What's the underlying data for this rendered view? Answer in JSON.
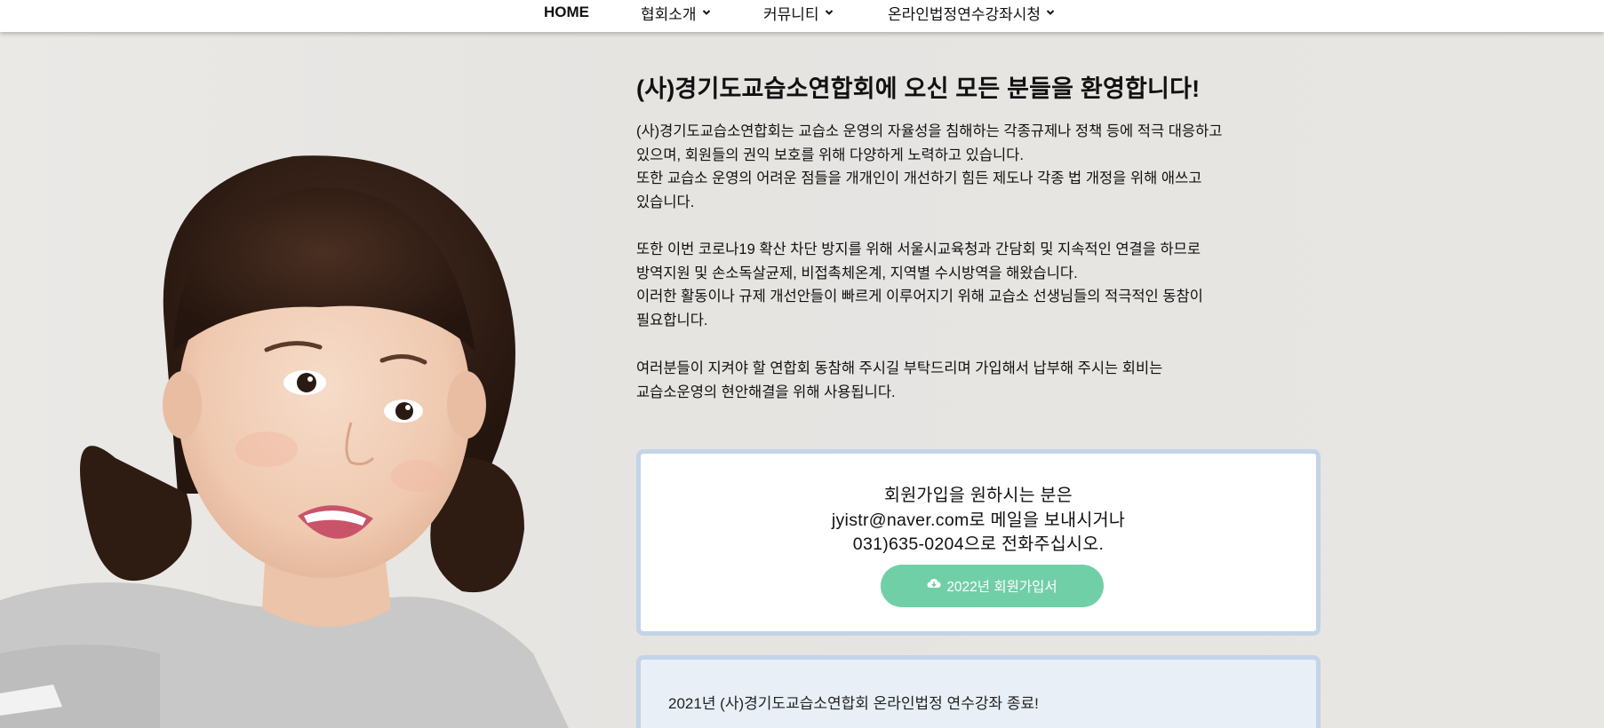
{
  "nav": {
    "items": [
      {
        "label": "HOME",
        "has_dropdown": false
      },
      {
        "label": "협회소개",
        "has_dropdown": true
      },
      {
        "label": "커뮤니티",
        "has_dropdown": true
      },
      {
        "label": "온라인법정연수강좌시청",
        "has_dropdown": true
      }
    ]
  },
  "intro": {
    "headline": "(사)경기도교습소연합회에 오신 모든 분들을 환영합니다!",
    "paragraph1": [
      "(사)경기도교습소연합회는 교습소 운영의 자율성을 침해하는 각종규제나 정책 등에 적극 대응하고",
      "있으며, 회원들의 권익 보호를 위해 다양하게 노력하고 있습니다.",
      "또한 교습소 운영의 어려운 점들을 개개인이 개선하기 힘든 제도나 각종 법 개정을 위해 애쓰고",
      "있습니다."
    ],
    "paragraph2": [
      "또한 이번 코로나19 확산 차단 방지를 위해 서울시교육청과 간담회 및 지속적인 연결을 하므로",
      "방역지원 및 손소독살균제, 비접촉체온계, 지역별 수시방역을 해왔습니다.",
      "이러한 활동이나 규제 개선안들이 빠르게 이루어지기 위해 교습소 선생님들의 적극적인 동참이",
      "필요합니다."
    ],
    "paragraph3": [
      "여러분들이 지켜야 할 연합회 동참해 주시길 부탁드리며 가입해서 납부해 주시는 회비는",
      "교습소운영의 현안해결을 위해 사용됩니다."
    ]
  },
  "membership": {
    "lines": [
      "회원가입을 원하시는 분은",
      "jyistr@naver.com로 메일을 보내시거나",
      "031)635-0204으로 전화주십시오."
    ],
    "button_label": "2022년 회원가입서",
    "button_icon": "cloud-download-icon"
  },
  "notice": {
    "title": "2021년 (사)경기도교습소연합회 온라인법정 연수강좌 종료!"
  },
  "colors": {
    "accent": "#71cfa8",
    "card_border": "#c4d3e8",
    "notice_bg": "#e8eff6",
    "page_bg": "#e9e7e4"
  }
}
